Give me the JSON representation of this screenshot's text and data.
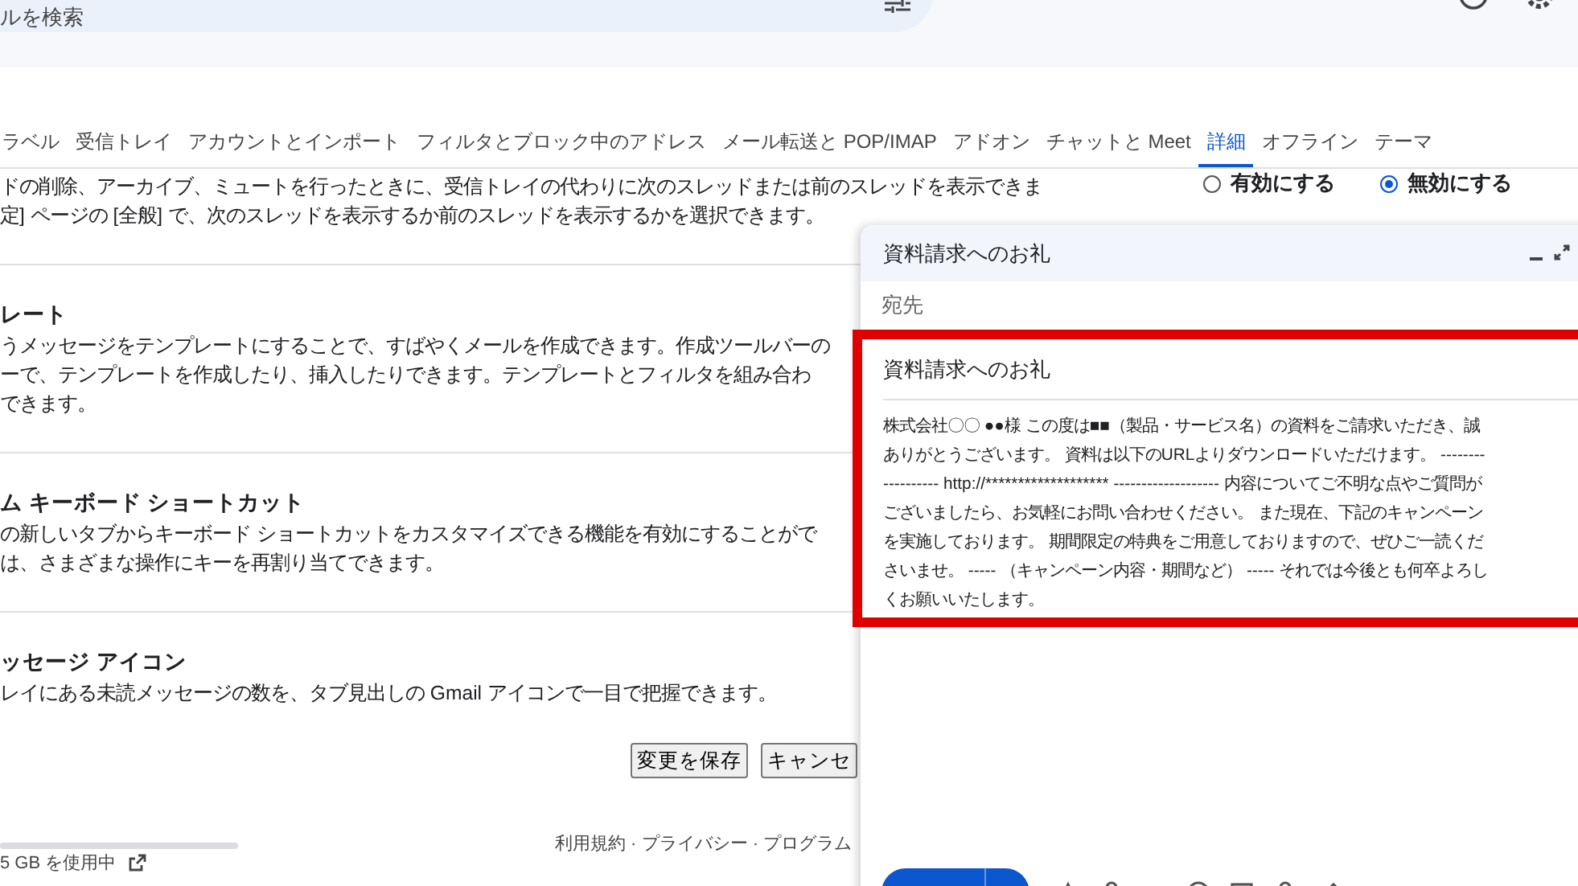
{
  "search": {
    "placeholder": "ルを検索"
  },
  "tabs": [
    {
      "label": "ラベル",
      "selected": false
    },
    {
      "label": "受信トレイ",
      "selected": false
    },
    {
      "label": "アカウントとインポート",
      "selected": false
    },
    {
      "label": "フィルタとブロック中のアドレス",
      "selected": false
    },
    {
      "label": "メール転送と POP/IMAP",
      "selected": false
    },
    {
      "label": "アドオン",
      "selected": false
    },
    {
      "label": "チャットと Meet",
      "selected": false
    },
    {
      "label": "詳細",
      "selected": true
    },
    {
      "label": "オフライン",
      "selected": false
    },
    {
      "label": "テーマ",
      "selected": false
    }
  ],
  "settings": [
    {
      "lines": [
        "ドの削除、アーカイブ、ミュートを行ったときに、受信トレイの代わりに次のスレッドまたは前のスレッドを表示できま",
        "定] ページの [全般] で、次のスレッドを表示するか前のスレッドを表示するかを選択できます。"
      ],
      "options": [
        {
          "label": "有効にする",
          "selected": false
        },
        {
          "label": "無効にする",
          "selected": true
        }
      ]
    },
    {
      "title": "レート",
      "lines": [
        "うメッセージをテンプレートにすることで、すばやくメールを作成できます。作成ツールバーの",
        "ーで、テンプレートを作成したり、挿入したりできます。テンプレートとフィルタを組み合わ",
        "できます。"
      ]
    },
    {
      "title": "ム キーボード ショートカット",
      "lines": [
        "の新しいタブからキーボード ショートカットをカスタマイズできる機能を有効にすることがで",
        "は、さまざまな操作にキーを再割り当てできます。"
      ]
    },
    {
      "title": "ッセージ アイコン",
      "lines": [
        "レイにある未読メッセージの数を、タブ見出しの Gmail アイコンで一目で把握できます。"
      ]
    }
  ],
  "buttons": [
    "変更を保存",
    "キャンセ"
  ],
  "footer": {
    "storage": "5 GB を使用中",
    "legal": "利用規約 · プライバシー · プログラム"
  },
  "compose": {
    "title": "資料請求へのお礼",
    "to_placeholder": "宛先",
    "subject": "資料請求へのお礼",
    "body_lines": [
      "株式会社〇〇 ●●様 この度は■■（製品・サービス名）の資料をご請求いただき、誠",
      "ありがとうございます。 資料は以下のURLよりダウンロードいただけます。 --------",
      "---------- http://******************* ------------------- 内容についてご不明な点やご質問が",
      "ございましたら、お気軽にお問い合わせください。 また現在、下記のキャンペーン",
      "を実施しております。 期間限定の特典をご用意しておりますので、ぜひご一読くだ",
      "さいませ。 ----- （キャンペーン内容・期間など） ----- それでは今後とも何卒よろし",
      "くお願いいたします。"
    ]
  }
}
